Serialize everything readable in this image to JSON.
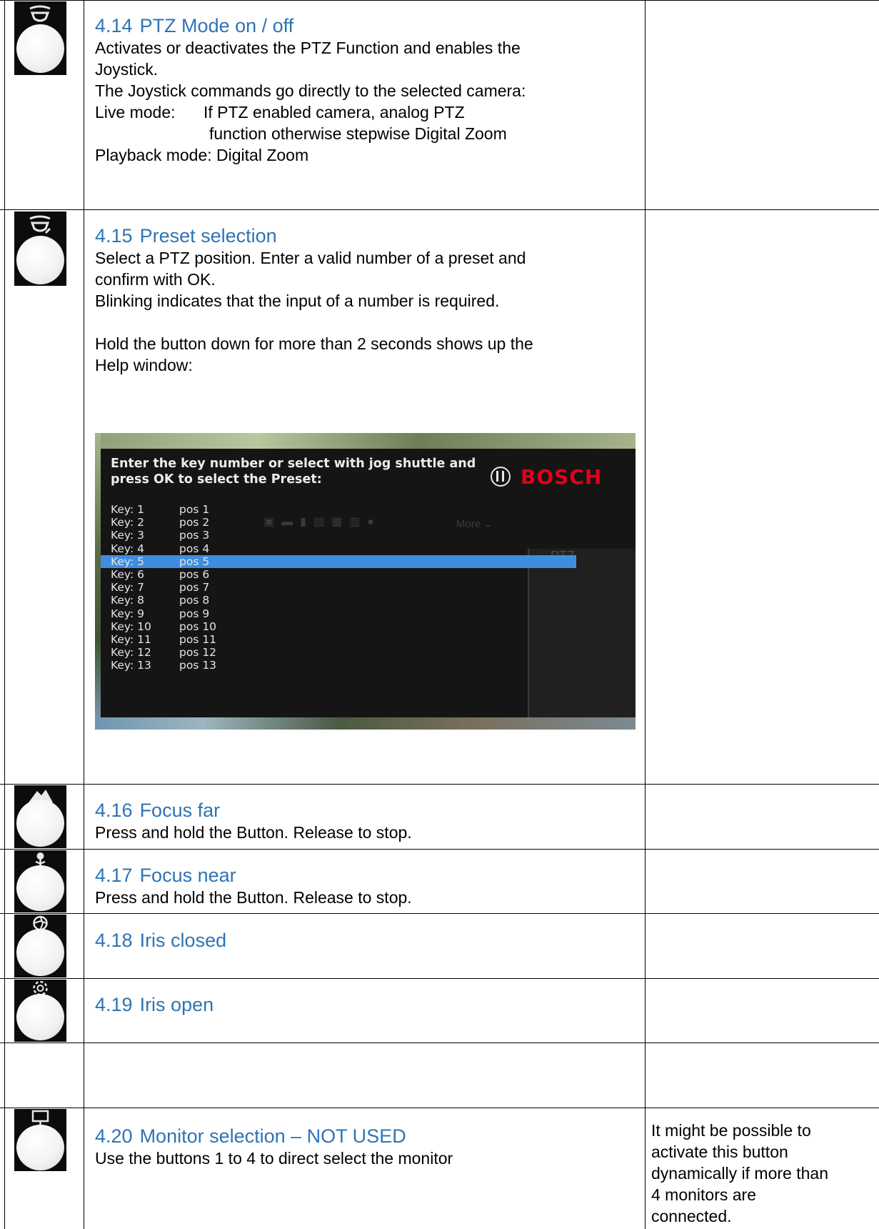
{
  "rows": [
    {
      "icon": "pan-tilt-icon",
      "heading_num": "4.14",
      "heading": "PTZ Mode on / off",
      "lines": [
        "Activates or deactivates the PTZ Function and enables the",
        "Joystick.",
        "The Joystick commands go directly to the selected camera:"
      ],
      "live_label": "Live mode:",
      "live_text": "If PTZ enabled camera, analog PTZ",
      "live_text2": "function otherwise stepwise Digital Zoom",
      "playback": "Playback mode: Digital Zoom"
    },
    {
      "icon": "preset-icon",
      "heading_num": "4.15",
      "heading": "Preset selection",
      "lines": [
        "Select a PTZ position. Enter a valid number of a preset and",
        "confirm with OK.",
        "Blinking indicates that the input of a number is required.",
        "",
        "Hold the button down for more than 2 seconds shows up the",
        "Help window:"
      ]
    },
    {
      "icon": "mountain-icon",
      "heading_num": "4.16",
      "heading": "Focus far",
      "text": "Press and hold the Button. Release to stop."
    },
    {
      "icon": "flower-icon",
      "heading_num": "4.17",
      "heading": "Focus near",
      "text": "Press and hold the Button. Release to stop."
    },
    {
      "icon": "iris-closed-icon",
      "heading_num": "4.18",
      "heading": "Iris closed"
    },
    {
      "icon": "iris-open-icon",
      "heading_num": "4.19",
      "heading": "Iris open"
    },
    {
      "icon": "monitor-icon",
      "heading_num": "4.20",
      "heading": "Monitor selection – NOT USED",
      "text": "Use the buttons 1 to 4 to direct select the monitor",
      "note": [
        "It might be possible to",
        "activate this button",
        "dynamically if more than",
        "4 monitors are",
        "connected."
      ]
    }
  ],
  "help_window": {
    "title_line1": "Enter the key number or select with jog shuttle and",
    "title_line2": "press OK to select the Preset:",
    "logo": "BOSCH",
    "background_more": "More",
    "background_ptz": "PTZ",
    "selected_index": 4,
    "items": [
      {
        "key": "Key: 1",
        "pos": "pos 1"
      },
      {
        "key": "Key: 2",
        "pos": "pos 2"
      },
      {
        "key": "Key: 3",
        "pos": "pos 3"
      },
      {
        "key": "Key: 4",
        "pos": "pos 4"
      },
      {
        "key": "Key: 5",
        "pos": "pos 5"
      },
      {
        "key": "Key: 6",
        "pos": "pos 6"
      },
      {
        "key": "Key: 7",
        "pos": "pos 7"
      },
      {
        "key": "Key: 8",
        "pos": "pos 8"
      },
      {
        "key": "Key: 9",
        "pos": "pos 9"
      },
      {
        "key": "Key: 10",
        "pos": "pos 10"
      },
      {
        "key": "Key: 11",
        "pos": "pos 11"
      },
      {
        "key": "Key: 12",
        "pos": "pos 12"
      },
      {
        "key": "Key: 13",
        "pos": "pos 13"
      }
    ]
  },
  "colors": {
    "heading": "#2e74b5",
    "selection": "#3d8ee0",
    "bosch_red": "#e3001b"
  }
}
